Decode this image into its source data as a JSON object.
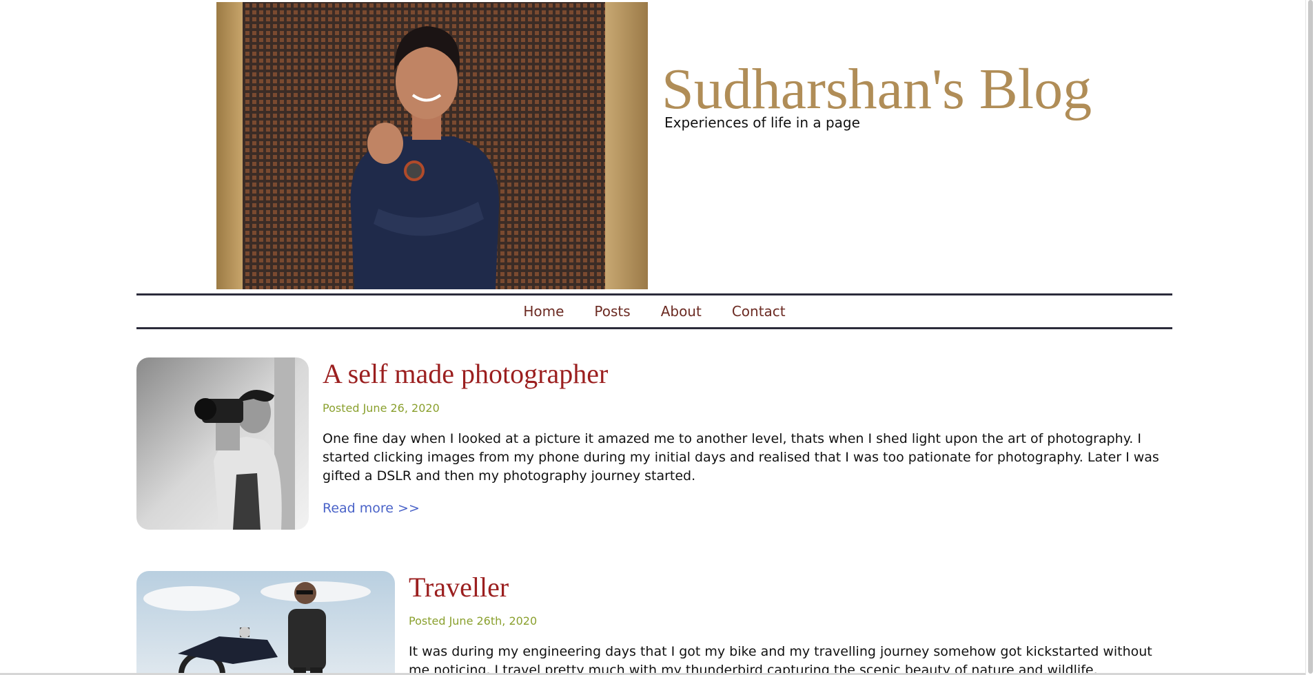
{
  "header": {
    "title": "Sudharshan's Blog",
    "tagline": "Experiences of life in a page",
    "photo_icon": "portrait-photo"
  },
  "nav": {
    "items": [
      {
        "label": "Home"
      },
      {
        "label": "Posts"
      },
      {
        "label": "About"
      },
      {
        "label": "Contact"
      }
    ]
  },
  "posts": [
    {
      "title": "A self made photographer",
      "date": "Posted June 26, 2020",
      "body": "One fine day when I looked at a picture it amazed me to another level, thats when I shed light upon the art of photography. I started clicking images from my phone during my initial days and realised that I was too pationate for photography. Later I was gifted a DSLR and then my photography journey started.",
      "read_more": "Read more >>",
      "image_icon": "photographer-photo"
    },
    {
      "title": "Traveller",
      "date": "Posted June 26th, 2020",
      "body": "It was during my engineering days that I got my bike and my travelling journey somehow got kickstarted without me noticing. I travel pretty much with my thunderbird capturing the scenic beauty of nature and wildlife.",
      "image_icon": "motorbike-photo"
    }
  ],
  "colors": {
    "title_gold": "#b08d57",
    "nav_link": "#6b2a22",
    "post_title": "#9b1f1f",
    "post_date": "#8aa02e",
    "read_more": "#4a63c8",
    "nav_rule": "#2b2b3a"
  }
}
